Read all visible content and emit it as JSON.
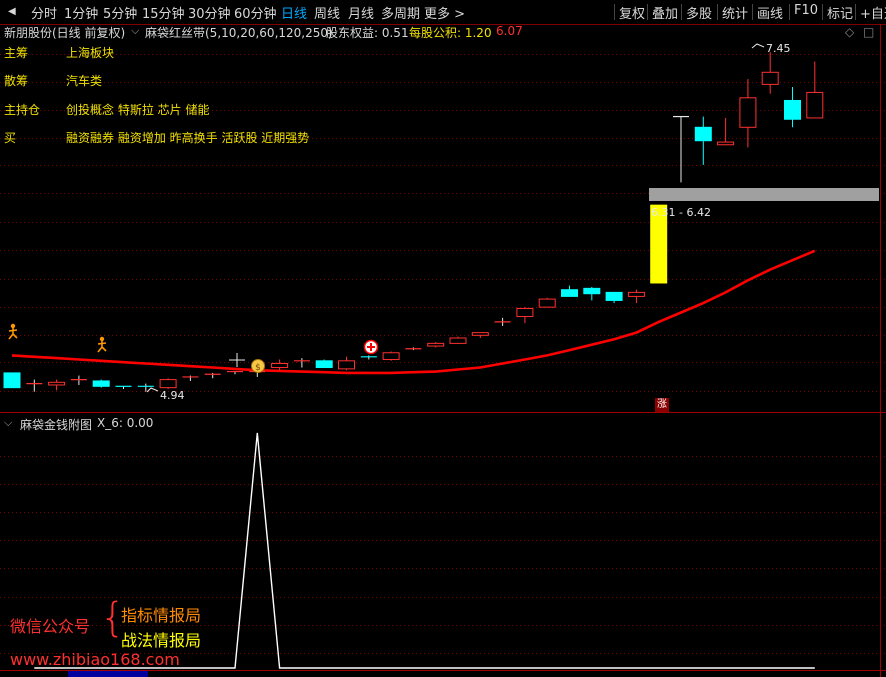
{
  "toolbar": {
    "left_items": [
      "分时",
      "1分钟",
      "5分钟",
      "15分钟",
      "30分钟",
      "60分钟",
      "日线",
      "周线",
      "月线",
      "多周期",
      "更多"
    ],
    "active": "日线",
    "right_items": [
      "复权",
      "叠加",
      "多股",
      "统计",
      "画线",
      "F10",
      "标记",
      "+自选"
    ]
  },
  "header": {
    "stock_title": "新朋股份(日线 前复权)",
    "indicator_name": "麻袋红丝带(5,10,20,60,120,250)",
    "equity_label": "股东权益: 0.51",
    "fund_label": "每股公积: 1.20",
    "extra_value": "6.07"
  },
  "info_rows": [
    {
      "label": "主筹",
      "value": "上海板块"
    },
    {
      "label": "散筹",
      "value": "汽车类"
    },
    {
      "label": "主持仓",
      "value": "创投概念 特斯拉 芯片 储能"
    },
    {
      "label": "买",
      "value": "融资融券 融资增加 昨高换手 活跃股 近期强势"
    }
  ],
  "main_chart": {
    "high_label": "7.45",
    "low_label": "4.94",
    "range_label": "6.31 - 6.42",
    "zhang_mark": "涨",
    "colors": {
      "up": "#ff3030",
      "down": "#00ffff",
      "ribbon": "#ff0000",
      "limit": "#ffff00",
      "band": "#a0a0a0"
    }
  },
  "sub_chart": {
    "title": "麻袋金钱附图",
    "value_label": "X_6: 0.00"
  },
  "watermark": {
    "left": "微信公众号",
    "line1": "指标情报局",
    "line2": "战法情报局",
    "url": "www.zhibiao168.com"
  },
  "chart_data": {
    "type": "candlestick",
    "candles": [
      {
        "o": 5.06,
        "c": 4.95,
        "h": 5.06,
        "l": 4.95
      },
      {
        "o": 4.98,
        "c": 4.98,
        "h": 5.01,
        "l": 4.92
      },
      {
        "o": 4.97,
        "c": 4.99,
        "h": 5.01,
        "l": 4.93
      },
      {
        "o": 5.01,
        "c": 5.01,
        "h": 5.04,
        "l": 4.97
      },
      {
        "o": 5.0,
        "c": 4.96,
        "h": 5.01,
        "l": 4.95
      },
      {
        "o": 4.96,
        "c": 4.95,
        "h": 4.96,
        "l": 4.94
      },
      {
        "o": 4.96,
        "c": 4.95,
        "h": 4.98,
        "l": 4.92
      },
      {
        "o": 4.95,
        "c": 5.01,
        "h": 5.02,
        "l": 4.94
      },
      {
        "o": 5.02,
        "c": 5.03,
        "h": 5.04,
        "l": 5.0
      },
      {
        "o": 5.04,
        "c": 5.05,
        "h": 5.06,
        "l": 5.02
      },
      {
        "o": 5.06,
        "c": 5.07,
        "h": 5.07,
        "l": 5.05
      },
      {
        "o": 5.06,
        "c": 5.07,
        "h": 5.11,
        "l": 5.03
      },
      {
        "o": 5.1,
        "c": 5.13,
        "h": 5.16,
        "l": 5.08
      },
      {
        "o": 5.14,
        "c": 5.15,
        "h": 5.17,
        "l": 5.1
      },
      {
        "o": 5.15,
        "c": 5.1,
        "h": 5.16,
        "l": 5.1
      },
      {
        "o": 5.09,
        "c": 5.15,
        "h": 5.18,
        "l": 5.08
      },
      {
        "o": 5.18,
        "c": 5.17,
        "h": 5.19,
        "l": 5.16
      },
      {
        "o": 5.16,
        "c": 5.21,
        "h": 5.22,
        "l": 5.15
      },
      {
        "o": 5.23,
        "c": 5.24,
        "h": 5.25,
        "l": 5.23
      },
      {
        "o": 5.26,
        "c": 5.28,
        "h": 5.29,
        "l": 5.25
      },
      {
        "o": 5.28,
        "c": 5.32,
        "h": 5.33,
        "l": 5.28
      },
      {
        "o": 5.34,
        "c": 5.36,
        "h": 5.36,
        "l": 5.32
      },
      {
        "o": 5.43,
        "c": 5.44,
        "h": 5.47,
        "l": 5.41
      },
      {
        "o": 5.48,
        "c": 5.54,
        "h": 5.55,
        "l": 5.43
      },
      {
        "o": 5.55,
        "c": 5.61,
        "h": 5.62,
        "l": 5.55
      },
      {
        "o": 5.68,
        "c": 5.63,
        "h": 5.71,
        "l": 5.63
      },
      {
        "o": 5.69,
        "c": 5.65,
        "h": 5.7,
        "l": 5.6
      },
      {
        "o": 5.66,
        "c": 5.6,
        "h": 5.66,
        "l": 5.58
      },
      {
        "o": 5.63,
        "c": 5.66,
        "h": 5.68,
        "l": 5.58
      },
      {
        "o": 5.73,
        "c": 6.31,
        "h": 6.31,
        "l": 5.73
      },
      {
        "o": 6.97,
        "c": 6.97,
        "h": 6.97,
        "l": 6.48
      },
      {
        "o": 6.89,
        "c": 6.79,
        "h": 6.97,
        "l": 6.61
      },
      {
        "o": 6.76,
        "c": 6.78,
        "h": 6.96,
        "l": 6.76
      },
      {
        "o": 6.89,
        "c": 7.11,
        "h": 7.25,
        "l": 6.74
      },
      {
        "o": 7.21,
        "c": 7.3,
        "h": 7.45,
        "l": 7.14
      },
      {
        "o": 7.09,
        "c": 6.95,
        "h": 7.19,
        "l": 6.89
      },
      {
        "o": 6.96,
        "c": 7.15,
        "h": 7.38,
        "l": 6.96
      }
    ],
    "ribbon": [
      5.19,
      5.18,
      5.17,
      5.16,
      5.15,
      5.14,
      5.13,
      5.12,
      5.11,
      5.1,
      5.09,
      5.08,
      5.075,
      5.07,
      5.065,
      5.06,
      5.06,
      5.06,
      5.065,
      5.07,
      5.085,
      5.1,
      5.13,
      5.16,
      5.19,
      5.23,
      5.27,
      5.31,
      5.36,
      5.44,
      5.51,
      5.58,
      5.66,
      5.75,
      5.83,
      5.9,
      5.97
    ],
    "sub_values": [
      0,
      0,
      0,
      0,
      0,
      0,
      0,
      0,
      0,
      0,
      0,
      100,
      0,
      0,
      0,
      0,
      0,
      0,
      0,
      0,
      0,
      0,
      0,
      0,
      0,
      0,
      0,
      0,
      0,
      0,
      0,
      0,
      0,
      0,
      0,
      0,
      0
    ]
  }
}
